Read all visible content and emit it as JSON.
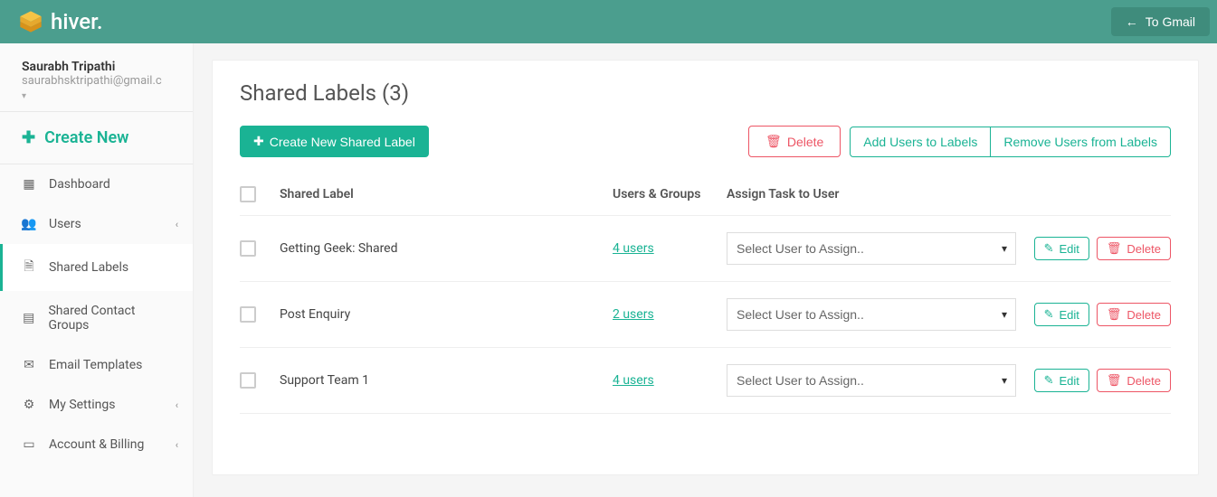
{
  "header": {
    "brand": "hiver.",
    "to_gmail_label": "To Gmail"
  },
  "user": {
    "name": "Saurabh Tripathi",
    "email": "saurabhsktripathi@gmail.c"
  },
  "sidebar": {
    "create_new_label": "Create New",
    "items": [
      {
        "label": "Dashboard",
        "has_sub": false
      },
      {
        "label": "Users",
        "has_sub": true
      },
      {
        "label": "Shared Labels",
        "has_sub": false
      },
      {
        "label": "Shared Contact Groups",
        "has_sub": false
      },
      {
        "label": "Email Templates",
        "has_sub": false
      },
      {
        "label": "My Settings",
        "has_sub": true
      },
      {
        "label": "Account & Billing",
        "has_sub": true
      }
    ]
  },
  "page": {
    "title": "Shared Labels (3)"
  },
  "actions": {
    "create_label": "Create New Shared Label",
    "delete_label": "Delete",
    "add_users_label": "Add Users to Labels",
    "remove_users_label": "Remove Users from Labels"
  },
  "columns": {
    "shared_label": "Shared Label",
    "users_groups": "Users & Groups",
    "assign": "Assign Task to User"
  },
  "row_labels": {
    "edit": "Edit",
    "delete": "Delete",
    "select_placeholder": "Select User to Assign.."
  },
  "rows": [
    {
      "label": "Getting Geek: Shared",
      "users": "4 users"
    },
    {
      "label": "Post Enquiry",
      "users": "2 users"
    },
    {
      "label": "Support Team 1",
      "users": "4 users"
    }
  ]
}
